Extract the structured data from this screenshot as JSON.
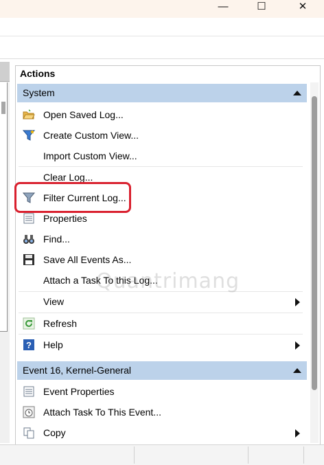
{
  "window": {
    "controls": {
      "minimize": "—",
      "maximize": "☐",
      "close": "✕"
    }
  },
  "actions": {
    "header": "Actions",
    "system_section": {
      "title": "System",
      "items": [
        {
          "label": "Open Saved Log...",
          "icon": "folder-open-icon"
        },
        {
          "label": "Create Custom View...",
          "icon": "funnel-star-icon"
        },
        {
          "label": "Import Custom View...",
          "icon": ""
        },
        {
          "label": "Clear Log...",
          "icon": ""
        },
        {
          "label": "Filter Current Log...",
          "icon": "funnel-icon"
        },
        {
          "label": "Properties",
          "icon": "properties-icon"
        },
        {
          "label": "Find...",
          "icon": "binoculars-icon"
        },
        {
          "label": "Save All Events As...",
          "icon": "floppy-disk-icon"
        },
        {
          "label": "Attach a Task To this Log...",
          "icon": ""
        },
        {
          "label": "View",
          "icon": "",
          "submenu": true
        },
        {
          "label": "Refresh",
          "icon": "refresh-icon"
        },
        {
          "label": "Help",
          "icon": "help-icon",
          "submenu": true
        }
      ]
    },
    "event_section": {
      "title": "Event 16, Kernel-General",
      "items": [
        {
          "label": "Event Properties",
          "icon": "event-properties-icon"
        },
        {
          "label": "Attach Task To This Event...",
          "icon": "clock-task-icon"
        },
        {
          "label": "Copy",
          "icon": "copy-icon",
          "submenu": true
        }
      ]
    }
  },
  "watermark": "Quantrimang",
  "colors": {
    "section_header_bg": "#bcd2ea",
    "highlight_border": "#d9202e",
    "titlebar_bg": "#fdf4ec"
  }
}
